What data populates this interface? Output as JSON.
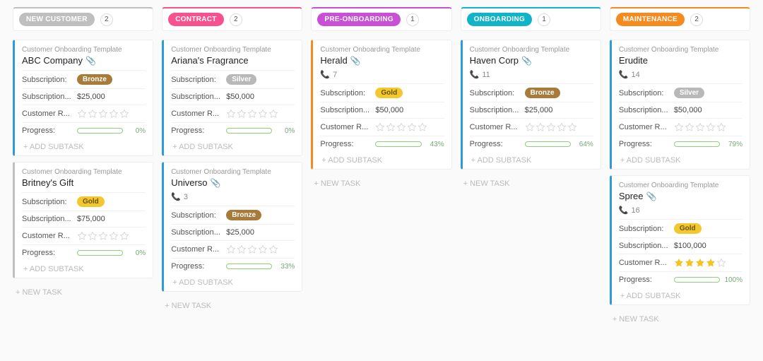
{
  "labels": {
    "template": "Customer Onboarding Template",
    "subscription": "Subscription:",
    "subscription_amount": "Subscription...",
    "customer_rating": "Customer R...",
    "progress": "Progress:",
    "add_subtask": "+ ADD SUBTASK",
    "new_task": "+ NEW TASK"
  },
  "columns": [
    {
      "id": "new-customer",
      "title": "NEW CUSTOMER",
      "count": "2",
      "accent": "gray",
      "cards": [
        {
          "title": "ABC Company",
          "clip": true,
          "tier": "Bronze",
          "tier_class": "tier-bronze",
          "amount": "$25,000",
          "rating": 0,
          "progress": 0,
          "card_accent": "c-blue"
        },
        {
          "title": "Britney's Gift",
          "tier": "Gold",
          "tier_class": "tier-gold",
          "amount": "$75,000",
          "rating": 0,
          "progress": 0,
          "card_accent": "c-gray"
        }
      ]
    },
    {
      "id": "contract",
      "title": "CONTRACT",
      "count": "2",
      "accent": "pink",
      "cards": [
        {
          "title": "Ariana's Fragrance",
          "tier": "Silver",
          "tier_class": "tier-silver",
          "amount": "$50,000",
          "rating": 0,
          "progress": 0,
          "card_accent": "c-blue"
        },
        {
          "title": "Universo",
          "clip": true,
          "phone": "3",
          "tier": "Bronze",
          "tier_class": "tier-bronze",
          "amount": "$25,000",
          "rating": 0,
          "progress": 33,
          "card_accent": "c-blue"
        }
      ]
    },
    {
      "id": "pre-onboarding",
      "title": "PRE-ONBOARDING",
      "count": "1",
      "accent": "magenta",
      "cards": [
        {
          "title": "Herald",
          "clip": true,
          "phone": "7",
          "tier": "Gold",
          "tier_class": "tier-gold",
          "amount": "$50,000",
          "rating": 0,
          "progress": 43,
          "card_accent": "c-orange"
        }
      ]
    },
    {
      "id": "onboarding",
      "title": "ONBOARDING",
      "count": "1",
      "accent": "teal",
      "cards": [
        {
          "title": "Haven Corp",
          "clip": true,
          "phone": "11",
          "tier": "Bronze",
          "tier_class": "tier-bronze",
          "amount": "$25,000",
          "rating": 0,
          "progress": 64,
          "card_accent": "c-blue"
        }
      ]
    },
    {
      "id": "maintenance",
      "title": "MAINTENANCE",
      "count": "2",
      "accent": "orange",
      "cards": [
        {
          "title": "Erudite",
          "phone": "14",
          "tier": "Silver",
          "tier_class": "tier-silver",
          "amount": "$50,000",
          "rating": 0,
          "progress": 79,
          "card_accent": "c-blue"
        },
        {
          "title": "Spree",
          "clip": true,
          "phone": "16",
          "tier": "Gold",
          "tier_class": "tier-gold",
          "amount": "$100,000",
          "rating": 4,
          "progress": 100,
          "card_accent": "c-blue"
        }
      ]
    }
  ]
}
